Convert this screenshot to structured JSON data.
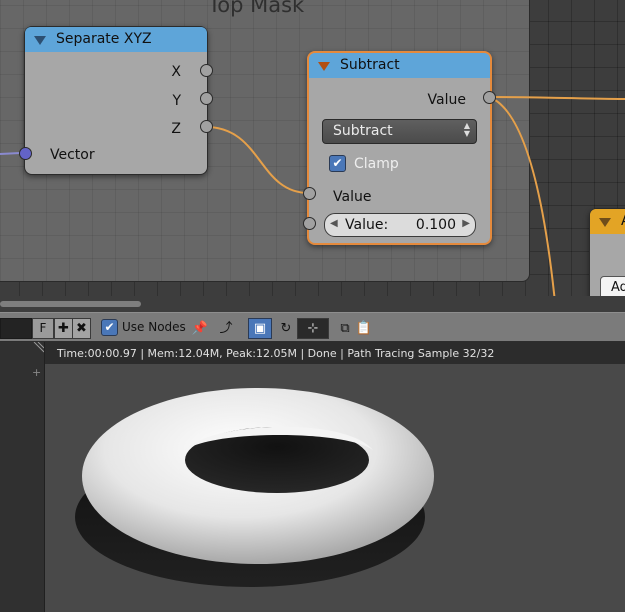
{
  "frame": {
    "label": "Top Mask"
  },
  "separate_node": {
    "title": "Separate XYZ",
    "outputs": [
      "X",
      "Y",
      "Z"
    ],
    "input": "Vector"
  },
  "subtract_node": {
    "title": "Subtract",
    "output": "Value",
    "operation": "Subtract",
    "clamp_label": "Clamp",
    "clamp_checked": true,
    "input_label": "Value",
    "field_label": "Value:",
    "field_value": "0.100"
  },
  "partial_node": {
    "title": "A",
    "field_text": "Ad"
  },
  "header": {
    "f_label": "F",
    "use_nodes_label": "Use Nodes",
    "use_nodes_checked": true
  },
  "viewer": {
    "status": "Time:00:00.97 | Mem:12.04M, Peak:12.05M | Done | Path Tracing Sample 32/32"
  },
  "colors": {
    "node_header_blue": "#5ea5d9",
    "node_active_outline": "#e58a3c",
    "wire": "#e5a04a",
    "vector_socket": "#6363c7",
    "accent_check": "#4a77b8"
  }
}
